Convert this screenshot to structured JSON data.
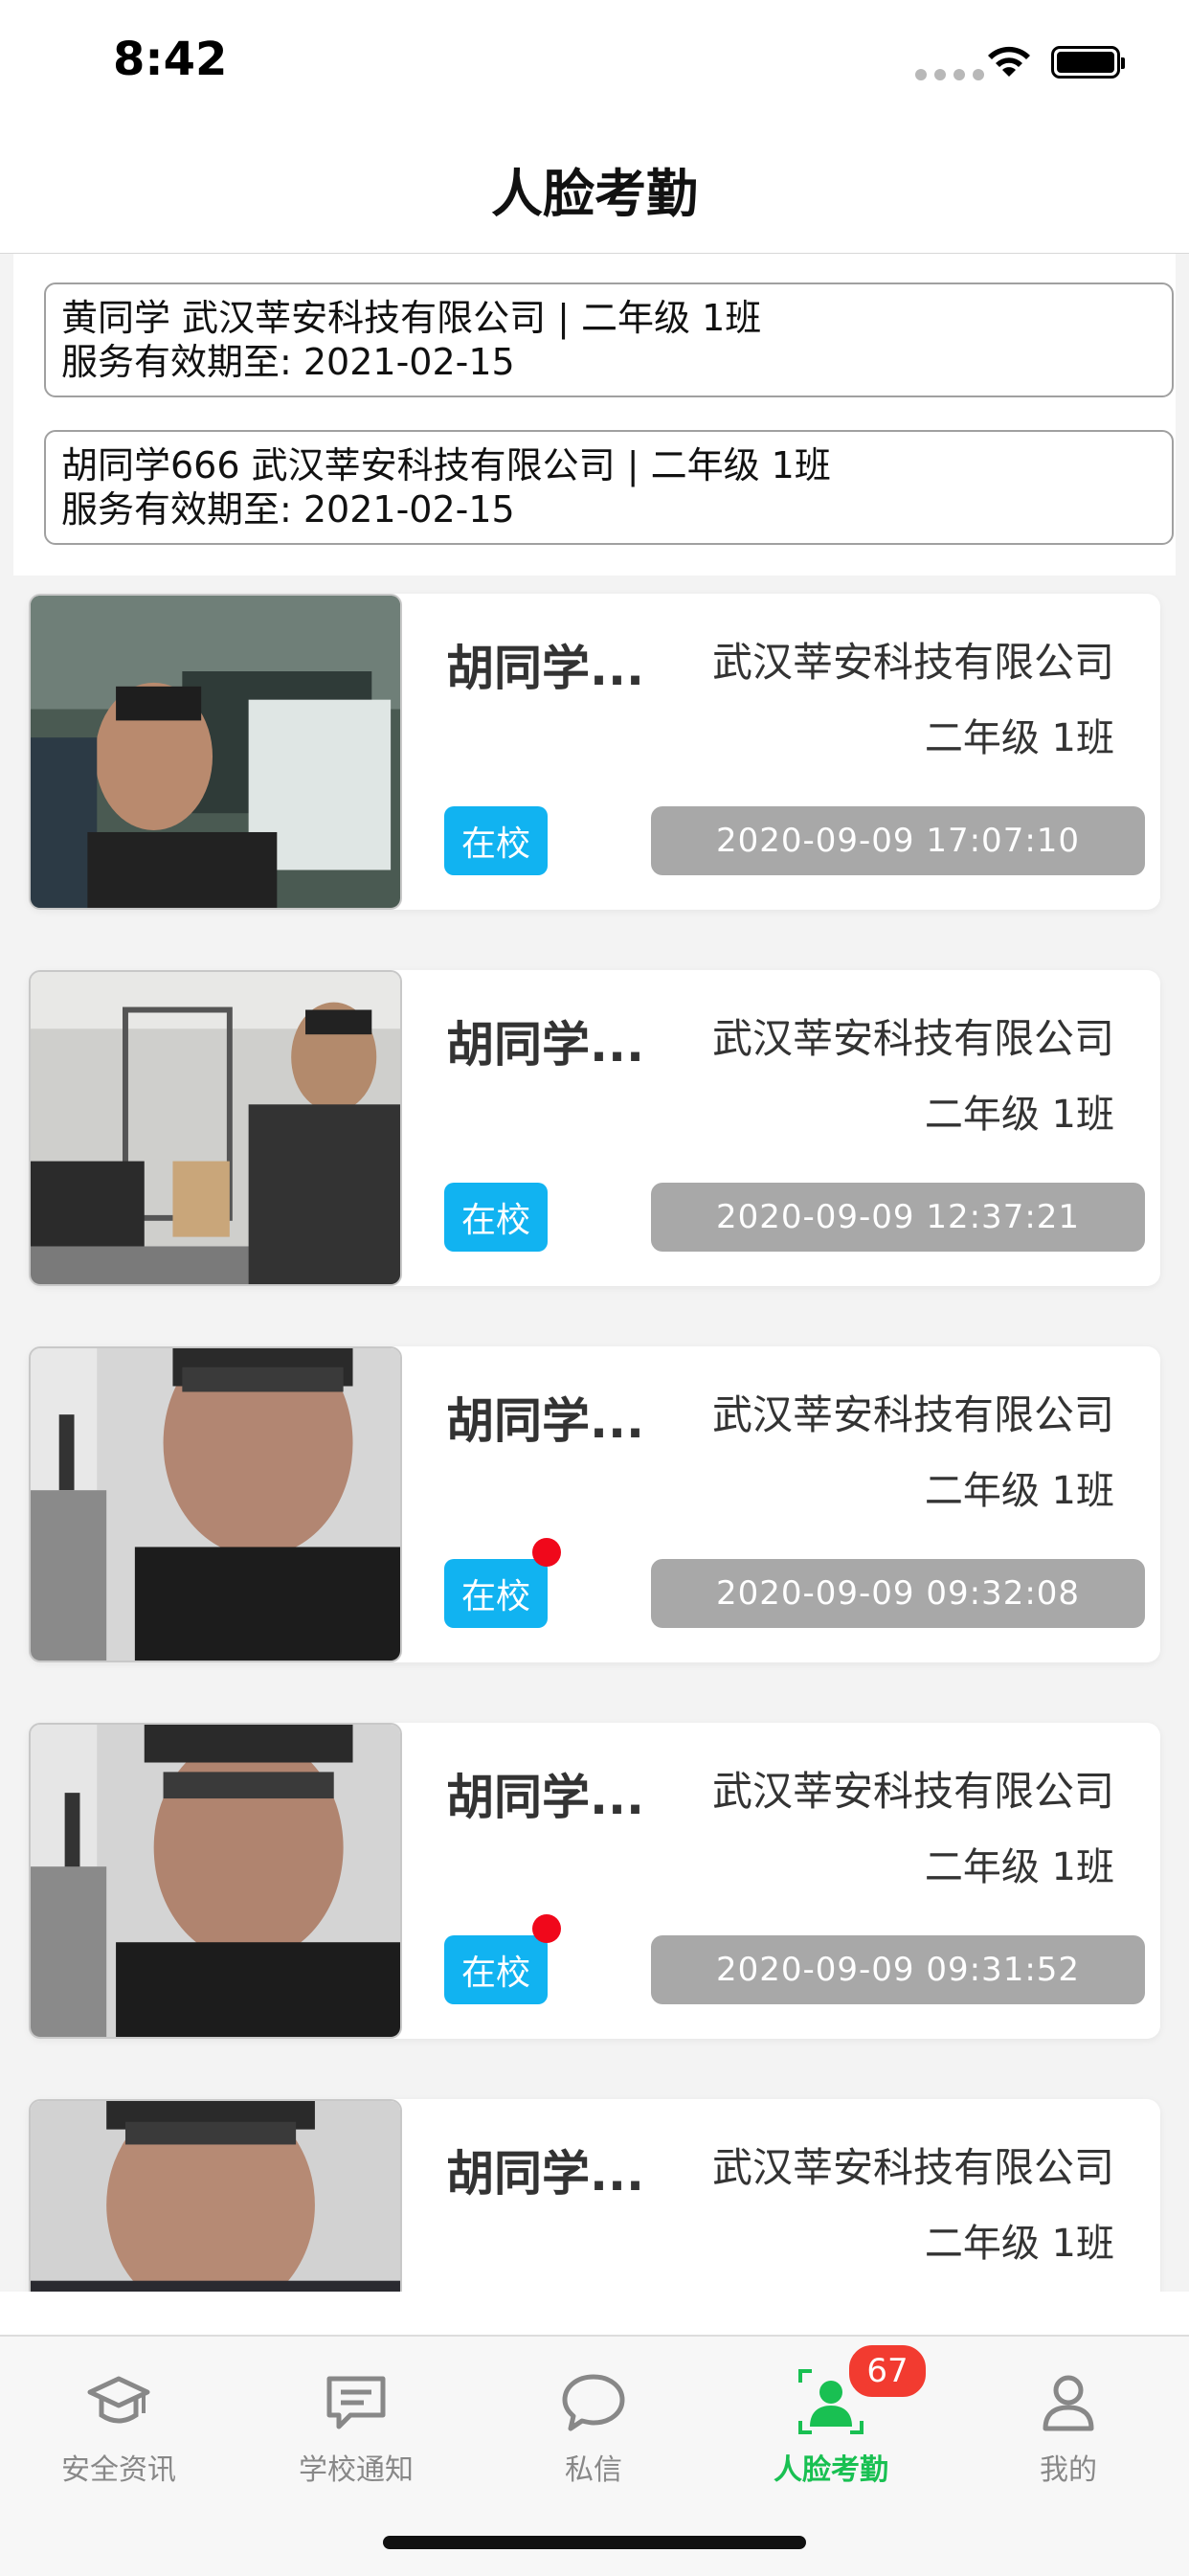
{
  "status_bar": {
    "time": "8:42"
  },
  "nav": {
    "title": "人脸考勤"
  },
  "info_cards": [
    {
      "line1": "黄同学  武汉莘安科技有限公司 | 二年级 1班",
      "line2": "服务有效期至: 2021-02-15"
    },
    {
      "line1": "胡同学666  武汉莘安科技有限公司 | 二年级 1班",
      "line2": "服务有效期至: 2021-02-15"
    }
  ],
  "records": [
    {
      "name": "胡同学...",
      "company": "武汉莘安科技有限公司",
      "class": "二年级 1班",
      "status": "在校",
      "time": "2020-09-09 17:07:10",
      "unread": false
    },
    {
      "name": "胡同学...",
      "company": "武汉莘安科技有限公司",
      "class": "二年级 1班",
      "status": "在校",
      "time": "2020-09-09 12:37:21",
      "unread": false
    },
    {
      "name": "胡同学...",
      "company": "武汉莘安科技有限公司",
      "class": "二年级 1班",
      "status": "在校",
      "time": "2020-09-09 09:32:08",
      "unread": true
    },
    {
      "name": "胡同学...",
      "company": "武汉莘安科技有限公司",
      "class": "二年级 1班",
      "status": "在校",
      "time": "2020-09-09 09:31:52",
      "unread": true
    },
    {
      "name": "胡同学...",
      "company": "武汉莘安科技有限公司",
      "class": "二年级 1班"
    }
  ],
  "tab_bar": {
    "items": [
      {
        "label": "安全资讯",
        "icon": "graduation-cap-icon"
      },
      {
        "label": "学校通知",
        "icon": "message-square-icon"
      },
      {
        "label": "私信",
        "icon": "chat-bubble-icon"
      },
      {
        "label": "人脸考勤",
        "icon": "face-scan-icon",
        "active": true,
        "badge": "67"
      },
      {
        "label": "我的",
        "icon": "user-icon"
      }
    ]
  },
  "colors": {
    "accent_green": "#19c052",
    "tag_blue": "#11b3f1",
    "badge_red": "#f23b30",
    "time_gray": "#a8a8a8"
  }
}
